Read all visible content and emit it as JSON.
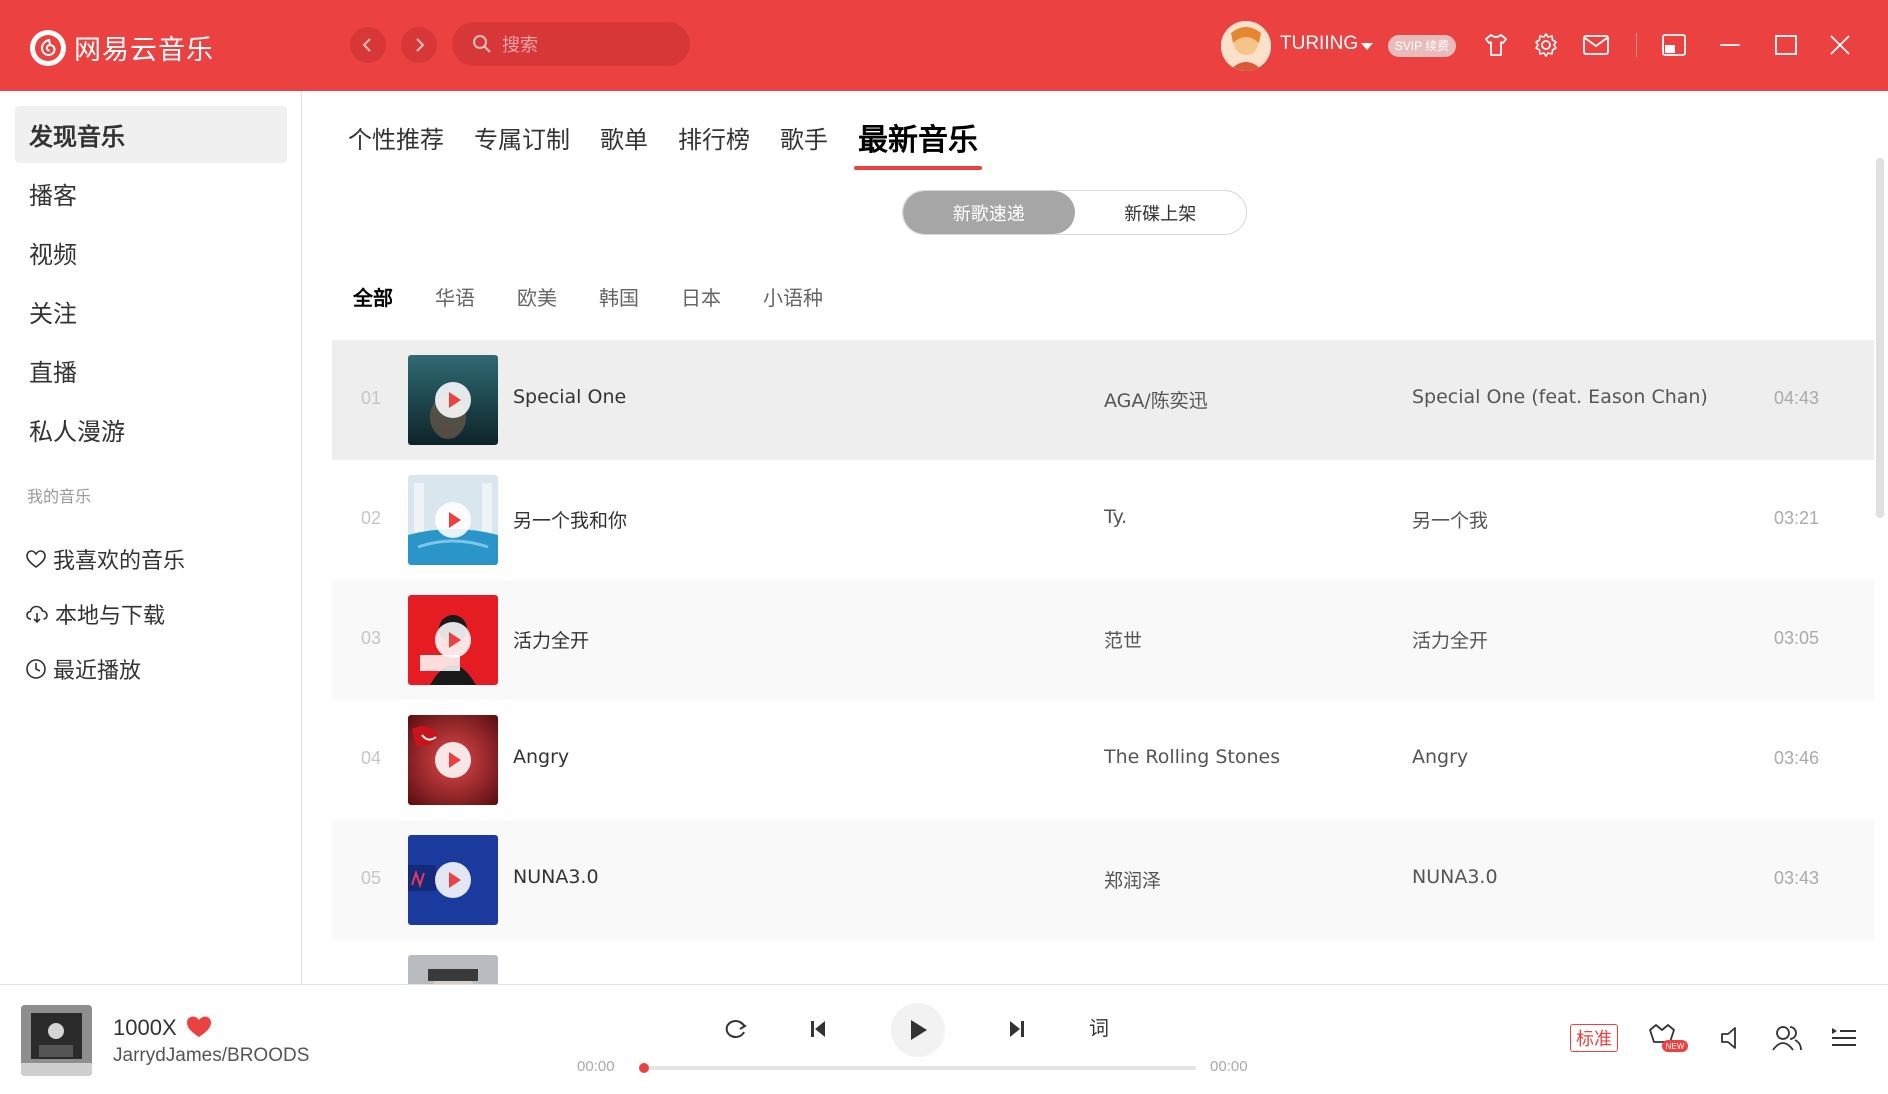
{
  "app": {
    "name": "网易云音乐",
    "brand_color": "#ec4141"
  },
  "search": {
    "placeholder": "搜索"
  },
  "user": {
    "name": "TURIING",
    "vip_badge": "SVIP 续费"
  },
  "sidebar": {
    "items": [
      {
        "label": "发现音乐",
        "active": true
      },
      {
        "label": "播客"
      },
      {
        "label": "视频"
      },
      {
        "label": "关注"
      },
      {
        "label": "直播"
      },
      {
        "label": "私人漫游"
      }
    ],
    "section_title": "我的音乐",
    "my_music": [
      {
        "label": "我喜欢的音乐",
        "icon": "heart-icon"
      },
      {
        "label": "本地与下载",
        "icon": "cloud-download-icon"
      },
      {
        "label": "最近播放",
        "icon": "clock-icon"
      }
    ]
  },
  "tabs": [
    {
      "label": "个性推荐"
    },
    {
      "label": "专属订制"
    },
    {
      "label": "歌单"
    },
    {
      "label": "排行榜"
    },
    {
      "label": "歌手"
    },
    {
      "label": "最新音乐",
      "active": true
    }
  ],
  "segment": {
    "left": "新歌速递",
    "right": "新碟上架",
    "active": "left"
  },
  "filters": [
    "全部",
    "华语",
    "欧美",
    "韩国",
    "日本",
    "小语种"
  ],
  "songs": [
    {
      "index": "01",
      "title": "Special One",
      "artist": "AGA/陈奕迅",
      "album": "Special One (feat. Eason Chan)",
      "duration": "04:43"
    },
    {
      "index": "02",
      "title": "另一个我和你",
      "artist": "Ty.",
      "album": "另一个我",
      "duration": "03:21"
    },
    {
      "index": "03",
      "title": "活力全开",
      "artist": "范世",
      "album": "活力全开",
      "duration": "03:05"
    },
    {
      "index": "04",
      "title": "Angry",
      "artist": "The Rolling Stones",
      "album": "Angry",
      "duration": "03:46"
    },
    {
      "index": "05",
      "title": "NUNA3.0",
      "artist": "郑润泽",
      "album": "NUNA3.0",
      "duration": "03:43"
    }
  ],
  "player": {
    "title": "1000X",
    "artist": "JarrydJames/BROODS",
    "current_time": "00:00",
    "total_time": "00:00",
    "progress": 0,
    "lyric_label": "词",
    "quality_label": "标准",
    "liked": true
  }
}
